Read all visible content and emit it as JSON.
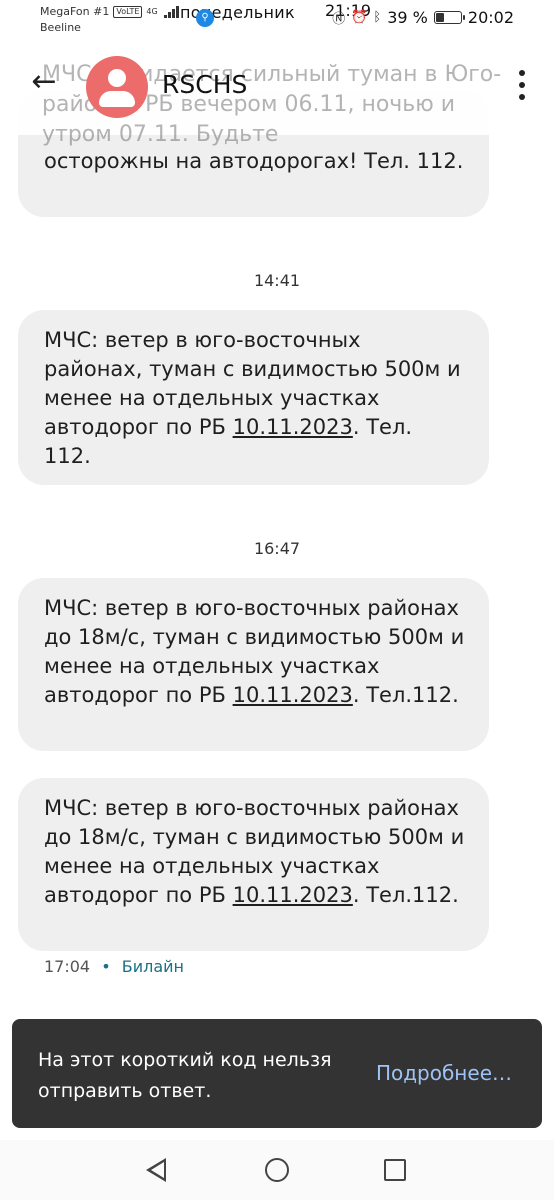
{
  "status_bar": {
    "carrier1": "MegaFon #1",
    "carrier2": "Beeline",
    "volte": "VoLTE",
    "network": "4G",
    "day": "понедельник",
    "clock_ghost": "21:19",
    "battery_pct": "39 %",
    "battery_level": 39,
    "time": "20:02"
  },
  "header": {
    "ghost_text": "МЧС: ожидается сильный туман в Юго-районах РБ вечером 06.11, ночью и утром 07.11. Будьте",
    "title": "RSCHS",
    "icons": [
      "back-arrow-icon",
      "contact-avatar-icon",
      "more-vert-icon"
    ]
  },
  "messages": [
    {
      "text": "осторожны на автодорогах!  Тел. 112."
    },
    {
      "time": "14:41",
      "pre": "МЧС: ветер в юго-восточных районах, туман с видимостью 500м и менее на отдельных участках автодорог по РБ ",
      "date": "10.11.2023",
      "post": ". Тел. 112."
    },
    {
      "time": "16:47",
      "pre": "МЧС: ветер в юго-восточных районах до 18м/с, туман с видимостью 500м и менее на отдельных участках автодорог по РБ ",
      "date": "10.11.2023",
      "post": ". Тел.112."
    },
    {
      "pre": "МЧС: ветер в юго-восточных районах до 18м/с, туман с видимостью 500м и менее на отдельных участках автодорог по РБ ",
      "date": "10.11.2023",
      "post": ". Тел.112."
    }
  ],
  "meta": {
    "time": "17:04",
    "separator": "•",
    "carrier": "Билайн"
  },
  "snackbar": {
    "text": "На этот короткий код нельзя отправить ответ.",
    "action": "Подробнее…"
  },
  "colors": {
    "bubble": "#efefef",
    "avatar": "#ec6b6b",
    "snackbar": "#333333",
    "link": "#9ec3f5"
  }
}
